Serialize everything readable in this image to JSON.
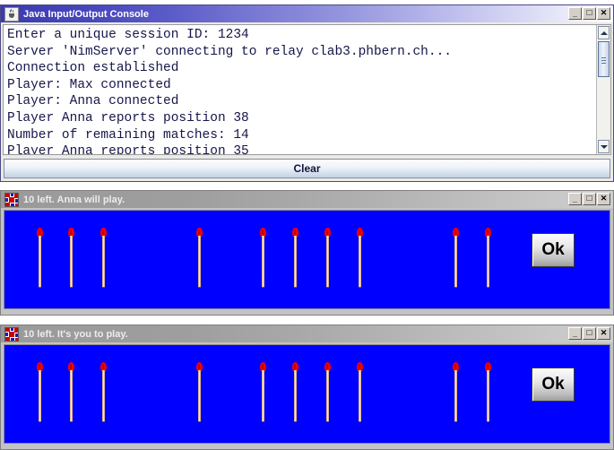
{
  "console_window": {
    "title": "Java Input/Output Console",
    "icon": "java-cup-icon",
    "window_buttons": {
      "minimize": "_",
      "maximize": "□",
      "close": "✕"
    },
    "output_lines": [
      "Enter a unique session ID: 1234",
      "Server 'NimServer' connecting to relay clab3.phbern.ch...",
      "Connection established",
      "Player: Max connected",
      "Player: Anna connected",
      "Player Anna reports position 38",
      "Number of remaining matches: 14",
      "Player Anna reports position 35"
    ],
    "clear_button": "Clear",
    "scrollbar": {
      "up_arrow": "▲",
      "down_arrow": "▼"
    }
  },
  "nim_windows": [
    {
      "title": "10 left. Anna will play.",
      "icon": "nim-pixel-icon",
      "ok_button": "Ok",
      "background_color": "#0000ff",
      "match_count": 10,
      "match_positions": [
        36,
        71,
        107,
        214,
        285,
        321,
        357,
        393,
        500,
        536
      ],
      "window_buttons": {
        "minimize": "_",
        "maximize": "□",
        "close": "✕"
      }
    },
    {
      "title": "10 left. It's you to play.",
      "icon": "nim-pixel-icon",
      "ok_button": "Ok",
      "background_color": "#0000ff",
      "match_count": 10,
      "match_positions": [
        36,
        71,
        107,
        214,
        285,
        321,
        357,
        393,
        500,
        536
      ],
      "window_buttons": {
        "minimize": "_",
        "maximize": "□",
        "close": "✕"
      }
    }
  ],
  "colors": {
    "game_background": "#0000ff",
    "match_head": "#f40000",
    "match_stick": "#f2d6b8",
    "active_title": "#3b3bb0",
    "inactive_title": "#9a9a9a"
  }
}
